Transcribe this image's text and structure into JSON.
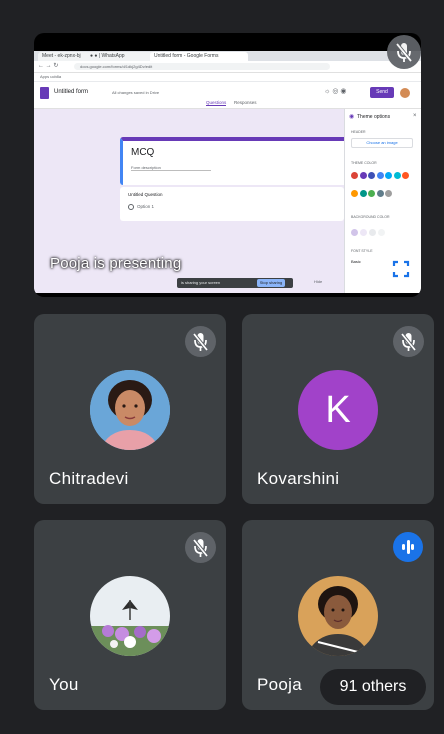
{
  "presentation": {
    "banner": "Pooja is presenting",
    "screen": {
      "tabs": [
        "Meet - ek-zpnx-bj",
        "● ● | WhatsApp",
        "Untitled form - Google Forms"
      ],
      "url": "docs.google.com/forms/d/1dkj2g4Dv/edit",
      "bookmarks": "Apps   ucb8a",
      "form_title": "Untitled form",
      "saved_text": "All changes saved in Drive",
      "send_label": "Send",
      "form_tabs": [
        "Questions",
        "Responses"
      ],
      "form_heading": "MCQ",
      "form_description": "Form description",
      "question_title": "Untitled Question",
      "option_label": "Option 1",
      "panel_title": "Theme options",
      "header_label": "HEADER",
      "choose_image": "Choose an image",
      "theme_color_label": "THEME COLOR",
      "background_color_label": "BACKGROUND COLOR",
      "font_style_label": "FONT STYLE",
      "font_style_value": "Basic",
      "share_text": "is sharing your screen",
      "stop_label": "Stop sharing",
      "hide_label": "Hide",
      "theme_colors": [
        "#db4437",
        "#673ab7",
        "#3f51b5",
        "#4285f4",
        "#03a9f4",
        "#00bcd4",
        "#ff5722",
        "#ff9800",
        "#009688",
        "#4caf50",
        "#607d8b",
        "#9e9e9e"
      ]
    }
  },
  "participants": [
    {
      "name": "Chitradevi"
    },
    {
      "name": "Kovarshini",
      "initial": "K",
      "avatar_color": "#a142c9"
    },
    {
      "name": "You"
    },
    {
      "name": "Pooja"
    }
  ],
  "others_label": "91 others",
  "icons": {
    "muted": "mic-off-icon",
    "speaking": "audio-level-icon",
    "fullscreen": "fullscreen-icon"
  }
}
